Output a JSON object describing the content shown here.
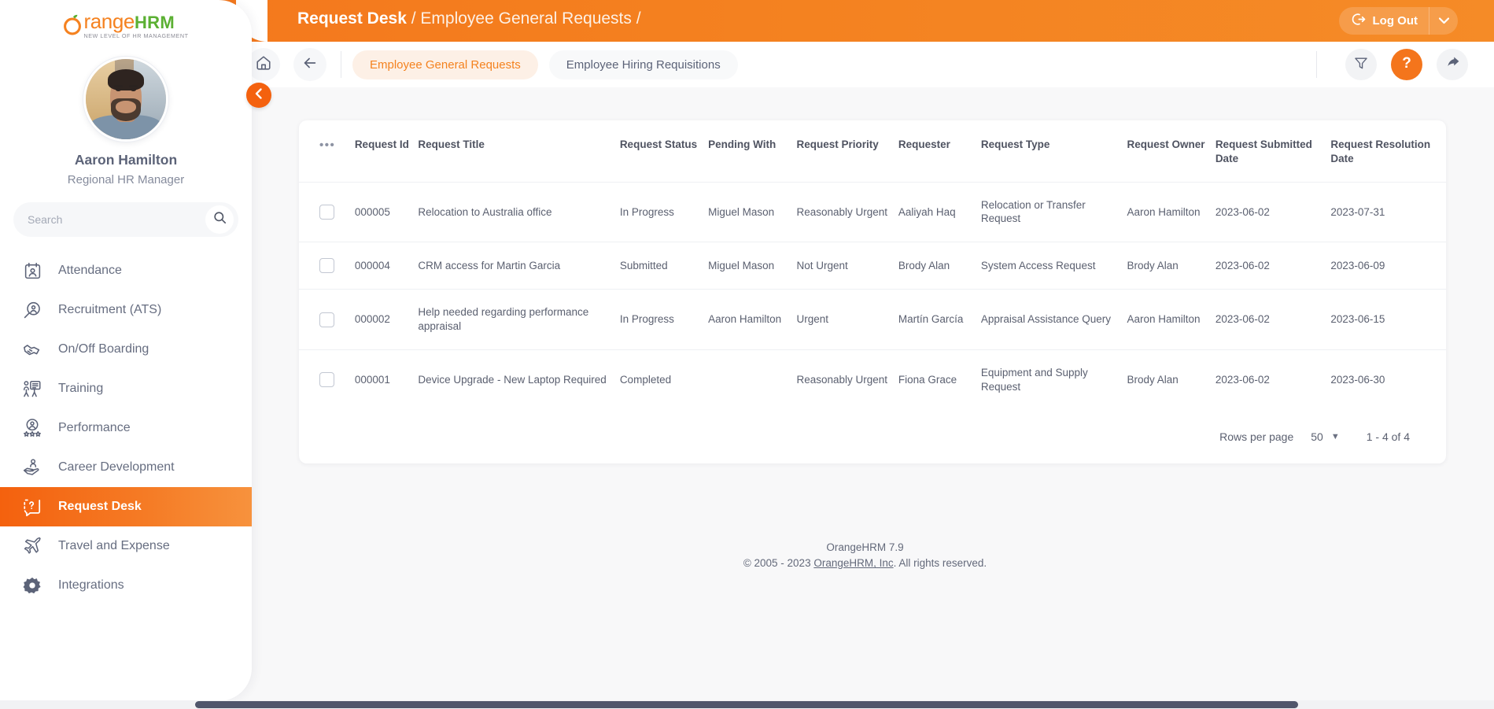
{
  "brand": {
    "name_orange": "range",
    "name_green": "HRM",
    "tagline": "NEW LEVEL OF HR MANAGEMENT"
  },
  "sidebar": {
    "user_name": "Aaron Hamilton",
    "user_role": "Regional HR Manager",
    "search_placeholder": "Search",
    "search_value": "",
    "search_icon": "search-icon",
    "collapse_icon": "chevron-left-icon",
    "active_color": "#f4610e",
    "items": [
      {
        "label": "Attendance",
        "icon": "attendance-calendar-icon",
        "active": false
      },
      {
        "label": "Recruitment (ATS)",
        "icon": "recruitment-magnifier-icon",
        "active": false
      },
      {
        "label": "On/Off Boarding",
        "icon": "handshake-icon",
        "active": false
      },
      {
        "label": "Training",
        "icon": "training-presentation-icon",
        "active": false
      },
      {
        "label": "Performance",
        "icon": "performance-stars-icon",
        "active": false
      },
      {
        "label": "Career Development",
        "icon": "career-hand-icon",
        "active": false
      },
      {
        "label": "Request Desk",
        "icon": "request-desk-chat-icon",
        "active": true
      },
      {
        "label": "Travel and Expense",
        "icon": "airplane-icon",
        "active": false
      },
      {
        "label": "Integrations",
        "icon": "gear-integrations-icon",
        "active": false
      }
    ]
  },
  "header": {
    "breadcrumb_root": "Request Desk",
    "breadcrumb_sep1": " / ",
    "breadcrumb_current": "Employee General Requests",
    "breadcrumb_sep2": " /",
    "logout_label": "Log Out",
    "logout_icon": "logout-arrow-icon",
    "logout_caret_icon": "chevron-down-icon",
    "brand_color": "#f4801f"
  },
  "toolbar": {
    "home_icon": "home-icon",
    "back_icon": "arrow-left-icon",
    "tabs": [
      {
        "label": "Employee General Requests",
        "active": true
      },
      {
        "label": "Employee Hiring Requisitions",
        "active": false
      }
    ],
    "filter_icon": "filter-funnel-icon",
    "help_icon": "question-mark-icon",
    "share_icon": "share-arrow-icon",
    "help_color": "#f4751c"
  },
  "table": {
    "menu_icon": "more-options-icon",
    "columns": [
      "Request Id",
      "Request Title",
      "Request Status",
      "Pending With",
      "Request Priority",
      "Requester",
      "Request Type",
      "Request Owner",
      "Request Submitted Date",
      "Request Resolution Date"
    ],
    "rows": [
      {
        "id": "000005",
        "title": "Relocation to Australia office",
        "status": "In Progress",
        "pending_with": "Miguel Mason",
        "priority": "Reasonably Urgent",
        "requester": "Aaliyah Haq",
        "type": "Relocation or Transfer Request",
        "owner": "Aaron Hamilton",
        "submitted": "2023-06-02",
        "resolution": "2023-07-31"
      },
      {
        "id": "000004",
        "title": "CRM access for Martin Garcia",
        "status": "Submitted",
        "pending_with": "Miguel Mason",
        "priority": "Not Urgent",
        "requester": "Brody Alan",
        "type": "System Access Request",
        "owner": "Brody Alan",
        "submitted": "2023-06-02",
        "resolution": "2023-06-09"
      },
      {
        "id": "000002",
        "title": "Help needed regarding performance appraisal",
        "status": "In Progress",
        "pending_with": "Aaron Hamilton",
        "priority": "Urgent",
        "requester": "Martín García",
        "type": "Appraisal Assistance Query",
        "owner": "Aaron Hamilton",
        "submitted": "2023-06-02",
        "resolution": "2023-06-15"
      },
      {
        "id": "000001",
        "title": "Device Upgrade - New Laptop Required",
        "status": "Completed",
        "pending_with": "",
        "priority": "Reasonably Urgent",
        "requester": "Fiona Grace",
        "type": "Equipment and Supply Request",
        "owner": "Brody Alan",
        "submitted": "2023-06-02",
        "resolution": "2023-06-30"
      }
    ]
  },
  "pagination": {
    "rows_per_page_label": "Rows per page",
    "rows_per_page_value": "50",
    "caret_icon": "chevron-down-icon",
    "range_label": "1 - 4 of 4"
  },
  "footer": {
    "version": "OrangeHRM 7.9",
    "copyright_prefix": "© 2005 - 2023 ",
    "company_link": "OrangeHRM, Inc",
    "copyright_suffix": ". All rights reserved."
  }
}
